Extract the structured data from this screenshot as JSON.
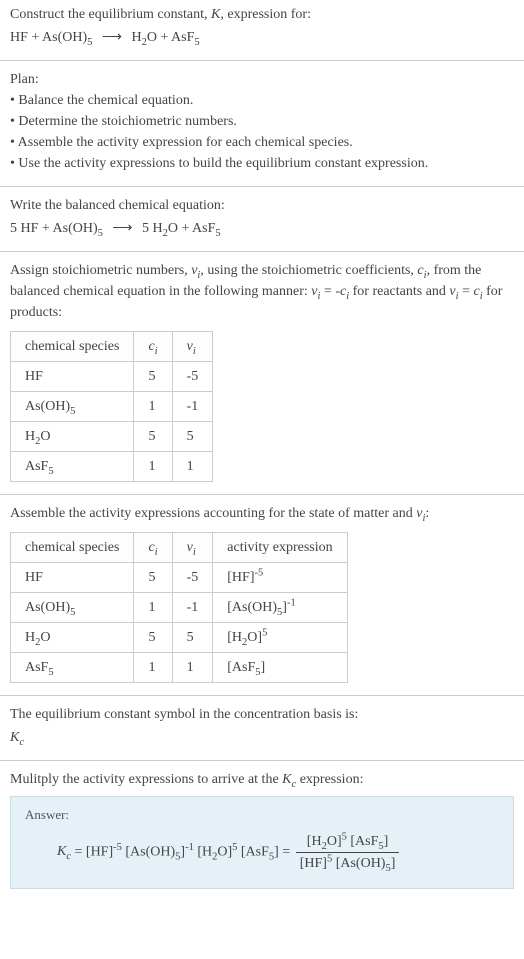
{
  "header": {
    "line1": "Construct the equilibrium constant, K, expression for:",
    "eq": "HF + As(OH)₅  ⟶  H₂O + AsF₅"
  },
  "plan": {
    "title": "Plan:",
    "items": [
      "Balance the chemical equation.",
      "Determine the stoichiometric numbers.",
      "Assemble the activity expression for each chemical species.",
      "Use the activity expressions to build the equilibrium constant expression."
    ]
  },
  "balanced": {
    "title": "Write the balanced chemical equation:",
    "eq": "5 HF + As(OH)₅  ⟶  5 H₂O + AsF₅"
  },
  "stoich": {
    "intro": "Assign stoichiometric numbers, νᵢ, using the stoichiometric coefficients, cᵢ, from the balanced chemical equation in the following manner: νᵢ = -cᵢ for reactants and νᵢ = cᵢ for products:",
    "headers": [
      "chemical species",
      "cᵢ",
      "νᵢ"
    ],
    "rows": [
      {
        "species": "HF",
        "c": "5",
        "v": "-5"
      },
      {
        "species": "As(OH)₅",
        "c": "1",
        "v": "-1"
      },
      {
        "species": "H₂O",
        "c": "5",
        "v": "5"
      },
      {
        "species": "AsF₅",
        "c": "1",
        "v": "1"
      }
    ]
  },
  "activity": {
    "intro": "Assemble the activity expressions accounting for the state of matter and νᵢ:",
    "headers": [
      "chemical species",
      "cᵢ",
      "νᵢ",
      "activity expression"
    ],
    "rows": [
      {
        "species": "HF",
        "c": "5",
        "v": "-5",
        "expr": "[HF]⁻⁵"
      },
      {
        "species": "As(OH)₅",
        "c": "1",
        "v": "-1",
        "expr": "[As(OH)₅]⁻¹"
      },
      {
        "species": "H₂O",
        "c": "5",
        "v": "5",
        "expr": "[H₂O]⁵"
      },
      {
        "species": "AsF₅",
        "c": "1",
        "v": "1",
        "expr": "[AsF₅]"
      }
    ]
  },
  "symbol": {
    "line": "The equilibrium constant symbol in the concentration basis is:",
    "sym": "K_c"
  },
  "multiply": {
    "line": "Mulitply the activity expressions to arrive at the K_c expression:"
  },
  "answer": {
    "label": "Answer:",
    "kc": "K_c",
    "lhs": "= [HF]⁻⁵ [As(OH)₅]⁻¹ [H₂O]⁵ [AsF₅] =",
    "num": "[H₂O]⁵ [AsF₅]",
    "den": "[HF]⁵ [As(OH)₅]"
  },
  "chart_data": {
    "type": "table",
    "tables": [
      {
        "title": "stoichiometric numbers",
        "columns": [
          "chemical species",
          "c_i",
          "v_i"
        ],
        "rows": [
          [
            "HF",
            5,
            -5
          ],
          [
            "As(OH)5",
            1,
            -1
          ],
          [
            "H2O",
            5,
            5
          ],
          [
            "AsF5",
            1,
            1
          ]
        ]
      },
      {
        "title": "activity expressions",
        "columns": [
          "chemical species",
          "c_i",
          "v_i",
          "activity expression"
        ],
        "rows": [
          [
            "HF",
            5,
            -5,
            "[HF]^-5"
          ],
          [
            "As(OH)5",
            1,
            -1,
            "[As(OH)5]^-1"
          ],
          [
            "H2O",
            5,
            5,
            "[H2O]^5"
          ],
          [
            "AsF5",
            1,
            1,
            "[AsF5]"
          ]
        ]
      }
    ]
  }
}
